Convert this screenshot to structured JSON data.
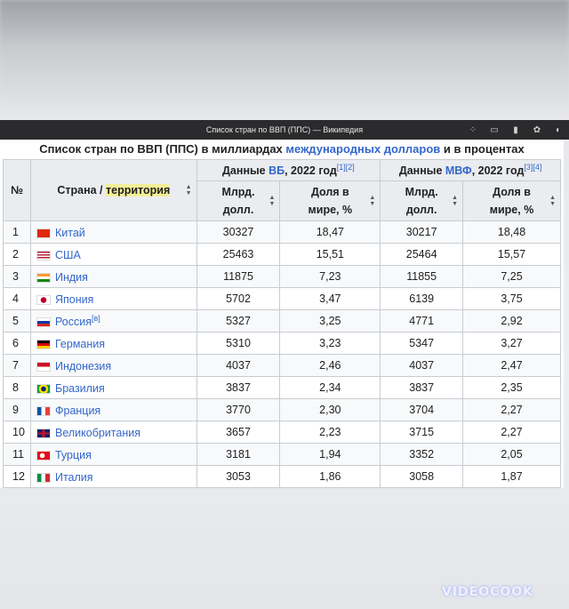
{
  "window": {
    "title": "Список стран по ВВП (ППС) — Википедия"
  },
  "table": {
    "caption_prefix": "Список стран по ВВП (ППС) в миллиардах ",
    "caption_link": "международных долларов",
    "caption_suffix": " и в процентах",
    "col_rank": "№",
    "col_country_prefix": "Страна / ",
    "col_country_highlight": "территория",
    "wb_prefix": "Данные ",
    "wb_link": "ВБ",
    "wb_suffix": ", 2022 год",
    "wb_refs": "[1][2]",
    "imf_prefix": "Данные ",
    "imf_link": "МВФ",
    "imf_suffix": ", 2022 год",
    "imf_refs": "[3][4]",
    "sub_billions": "Млрд. долл.",
    "sub_share": "Доля в мире, %",
    "rows": [
      {
        "rank": "1",
        "country": "Китай",
        "note": "",
        "flag": "cn",
        "wb": "30327",
        "wb_share": "18,47",
        "imf": "30217",
        "imf_share": "18,48"
      },
      {
        "rank": "2",
        "country": "США",
        "note": "",
        "flag": "us",
        "wb": "25463",
        "wb_share": "15,51",
        "imf": "25464",
        "imf_share": "15,57"
      },
      {
        "rank": "3",
        "country": "Индия",
        "note": "",
        "flag": "in",
        "wb": "11875",
        "wb_share": "7,23",
        "imf": "11855",
        "imf_share": "7,25"
      },
      {
        "rank": "4",
        "country": "Япония",
        "note": "",
        "flag": "jp",
        "wb": "5702",
        "wb_share": "3,47",
        "imf": "6139",
        "imf_share": "3,75"
      },
      {
        "rank": "5",
        "country": "Россия",
        "note": "[в]",
        "flag": "ru",
        "wb": "5327",
        "wb_share": "3,25",
        "imf": "4771",
        "imf_share": "2,92"
      },
      {
        "rank": "6",
        "country": "Германия",
        "note": "",
        "flag": "de",
        "wb": "5310",
        "wb_share": "3,23",
        "imf": "5347",
        "imf_share": "3,27"
      },
      {
        "rank": "7",
        "country": "Индонезия",
        "note": "",
        "flag": "id",
        "wb": "4037",
        "wb_share": "2,46",
        "imf": "4037",
        "imf_share": "2,47"
      },
      {
        "rank": "8",
        "country": "Бразилия",
        "note": "",
        "flag": "br",
        "wb": "3837",
        "wb_share": "2,34",
        "imf": "3837",
        "imf_share": "2,35"
      },
      {
        "rank": "9",
        "country": "Франция",
        "note": "",
        "flag": "fr",
        "wb": "3770",
        "wb_share": "2,30",
        "imf": "3704",
        "imf_share": "2,27"
      },
      {
        "rank": "10",
        "country": "Великобритания",
        "note": "",
        "flag": "gb",
        "wb": "3657",
        "wb_share": "2,23",
        "imf": "3715",
        "imf_share": "2,27"
      },
      {
        "rank": "11",
        "country": "Турция",
        "note": "",
        "flag": "tr",
        "wb": "3181",
        "wb_share": "1,94",
        "imf": "3352",
        "imf_share": "2,05"
      },
      {
        "rank": "12",
        "country": "Италия",
        "note": "",
        "flag": "it",
        "wb": "3053",
        "wb_share": "1,86",
        "imf": "3058",
        "imf_share": "1,87"
      }
    ]
  },
  "watermark": "VIDEOCOOK",
  "colors": {
    "link": "#3366cc",
    "header_bg": "#eaecf0",
    "highlight": "#f3ee96"
  }
}
